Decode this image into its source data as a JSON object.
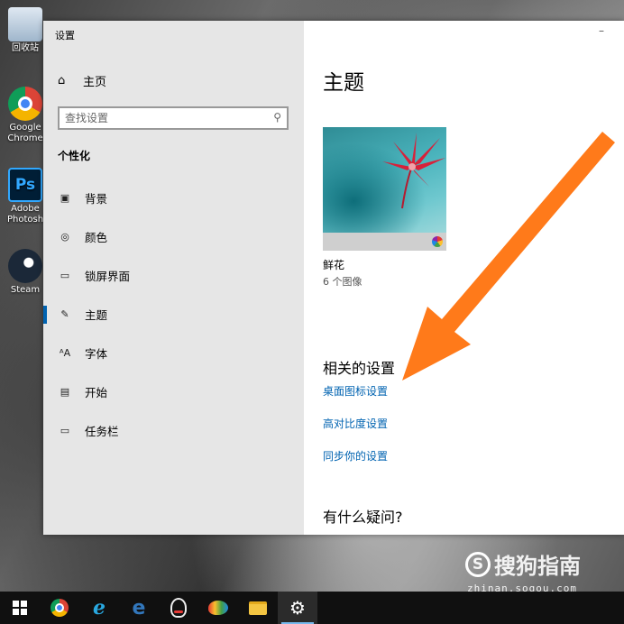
{
  "desktop": {
    "icons": [
      {
        "label": "回收站",
        "icon": "recycle-bin-icon"
      },
      {
        "label": "Google Chrome",
        "icon": "chrome-icon"
      },
      {
        "label": "Adobe Photosh",
        "icon": "photoshop-icon"
      },
      {
        "label": "Steam",
        "icon": "steam-icon"
      }
    ],
    "ps_glyph": "Ps"
  },
  "window": {
    "title": "设置",
    "minimize_glyph": "–"
  },
  "sidebar": {
    "home_label": "主页",
    "search_placeholder": "查找设置",
    "section_title": "个性化",
    "items": [
      {
        "label": "背景",
        "icon": "background-image-icon"
      },
      {
        "label": "颜色",
        "icon": "palette-icon"
      },
      {
        "label": "锁屏界面",
        "icon": "lock-screen-icon"
      },
      {
        "label": "主题",
        "icon": "theme-brush-icon",
        "active": true
      },
      {
        "label": "字体",
        "icon": "font-icon"
      },
      {
        "label": "开始",
        "icon": "start-icon"
      },
      {
        "label": "任务栏",
        "icon": "taskbar-icon"
      }
    ]
  },
  "content": {
    "title": "主题",
    "theme": {
      "name": "鲜花",
      "count": "6 个图像"
    },
    "related_title": "相关的设置",
    "links": [
      "桌面图标设置",
      "高对比度设置",
      "同步你的设置"
    ],
    "question_title": "有什么疑问?"
  },
  "watermark": {
    "brand": "搜狗指南",
    "logo_letter": "S",
    "url": "zhinan.sogou.com"
  },
  "colors": {
    "accent": "#0063b1",
    "sidebar_bg": "#e6e6e6",
    "arrow": "#ff7a1a",
    "taskbar": "#101010"
  },
  "taskbar": {
    "items": [
      "start-icon",
      "chrome-icon",
      "internet-explorer-icon",
      "edge-icon",
      "qq-icon",
      "paint-icon",
      "file-explorer-icon",
      "settings-gear-icon"
    ],
    "ie_glyph": "e",
    "edge_glyph": "e",
    "gear_glyph": "⚙"
  }
}
